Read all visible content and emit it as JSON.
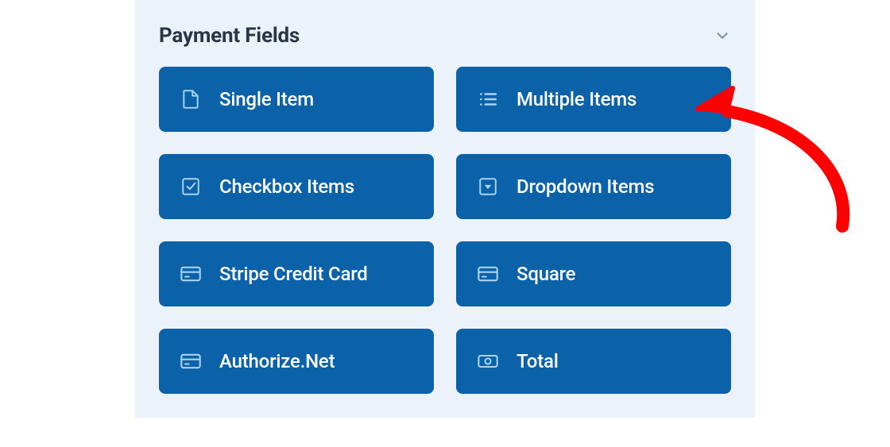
{
  "panel": {
    "title": "Payment Fields"
  },
  "fields": [
    {
      "label": "Single Item",
      "icon": "file-icon"
    },
    {
      "label": "Multiple Items",
      "icon": "list-icon"
    },
    {
      "label": "Checkbox Items",
      "icon": "checkbox-icon"
    },
    {
      "label": "Dropdown Items",
      "icon": "dropdown-icon"
    },
    {
      "label": "Stripe Credit Card",
      "icon": "card-icon"
    },
    {
      "label": "Square",
      "icon": "card-icon"
    },
    {
      "label": "Authorize.Net",
      "icon": "card-icon"
    },
    {
      "label": "Total",
      "icon": "money-icon"
    }
  ]
}
